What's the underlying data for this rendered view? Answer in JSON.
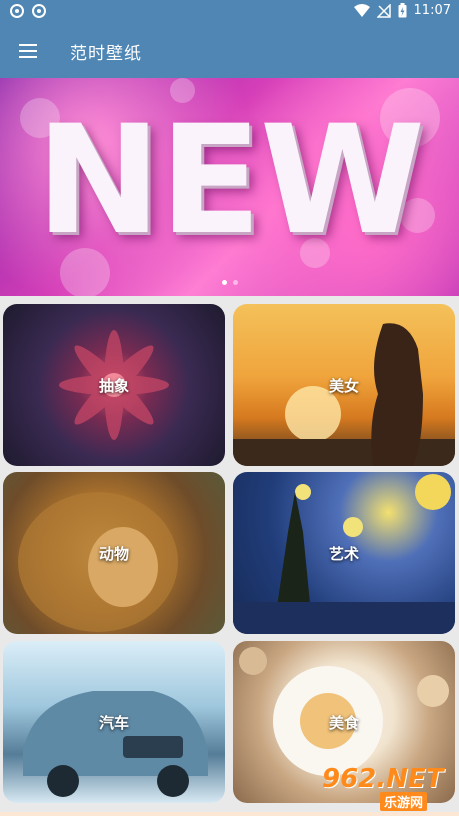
{
  "status_bar": {
    "time": "11:07"
  },
  "app": {
    "title": "范时壁纸"
  },
  "banner": {
    "word": "NEW"
  },
  "categories": [
    {
      "label": "抽象"
    },
    {
      "label": "美女"
    },
    {
      "label": "动物"
    },
    {
      "label": "艺术"
    },
    {
      "label": "汽车"
    },
    {
      "label": "美食"
    }
  ],
  "watermark": {
    "brand": "962.NET",
    "sub": "乐游网"
  },
  "colors": {
    "appbar": "#4f86b3",
    "background": "#e9e9e9"
  }
}
